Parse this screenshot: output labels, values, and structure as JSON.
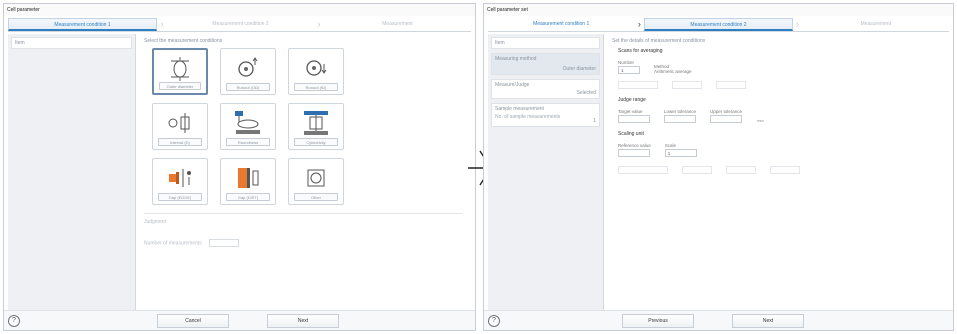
{
  "left_window": {
    "title": "Cell parameter",
    "steps": [
      "Measurement condition 1",
      "Measurement condition 2",
      "Measurement"
    ],
    "sidebar": [
      {
        "label": "Item"
      }
    ],
    "section_title": "Select the measurement conditions",
    "cards": [
      {
        "label": "Outer diameter",
        "icon": "outer-diameter-icon"
      },
      {
        "label": "Runout (OD)",
        "icon": "runout-od-icon"
      },
      {
        "label": "Runout (ID)",
        "icon": "runout-id-icon"
      },
      {
        "label": "Interval (D)",
        "icon": "interval-icon"
      },
      {
        "label": "Roundness",
        "icon": "roundness-icon"
      },
      {
        "label": "Cylindricity",
        "icon": "cylindricity-icon"
      },
      {
        "label": "Gap (EDGE)",
        "icon": "gap-edge-icon"
      },
      {
        "label": "Gap (DIST)",
        "icon": "gap-dist-icon"
      },
      {
        "label": "Other",
        "icon": "other-icon"
      }
    ],
    "lower_title": "Judgment",
    "lower_row_label": "Number of measurements",
    "footer": {
      "cancel": "Cancel",
      "next": "Next"
    }
  },
  "right_window": {
    "title": "Cell parameter set",
    "steps": [
      "Measurement condition 1",
      "Measurement condition 2",
      "Measurement"
    ],
    "sidebar": [
      {
        "label": "Item"
      },
      {
        "label": "Measuring method",
        "value": "Outer diameter"
      },
      {
        "label": "Measure/Judge",
        "value": "Selected"
      },
      {
        "label": "Sample measurement",
        "sub": "No. of sample measurements",
        "value": "1"
      }
    ],
    "section_title": "Set the details of measurement conditions",
    "scans_label": "Scans for averaging",
    "scans_fields": [
      {
        "label": "Number",
        "value": "1"
      },
      {
        "label": "Method",
        "value": "Arithmetic average"
      }
    ],
    "judge_label": "Judge range",
    "judge_fields": [
      {
        "label": "Target value",
        "value": ""
      },
      {
        "label": "Lower tolerance",
        "value": ""
      },
      {
        "label": "Upper tolerance",
        "value": ""
      }
    ],
    "unit_mm": "mm",
    "scaling_label": "Scaling unit",
    "scaling_fields": [
      {
        "label": "Reference value",
        "value": ""
      },
      {
        "label": "Scale",
        "value": "1"
      }
    ],
    "footer": {
      "previous": "Previous",
      "next": "Next"
    }
  },
  "colors": {
    "accent": "#2d7fc1",
    "panel": "#eef0f3"
  }
}
